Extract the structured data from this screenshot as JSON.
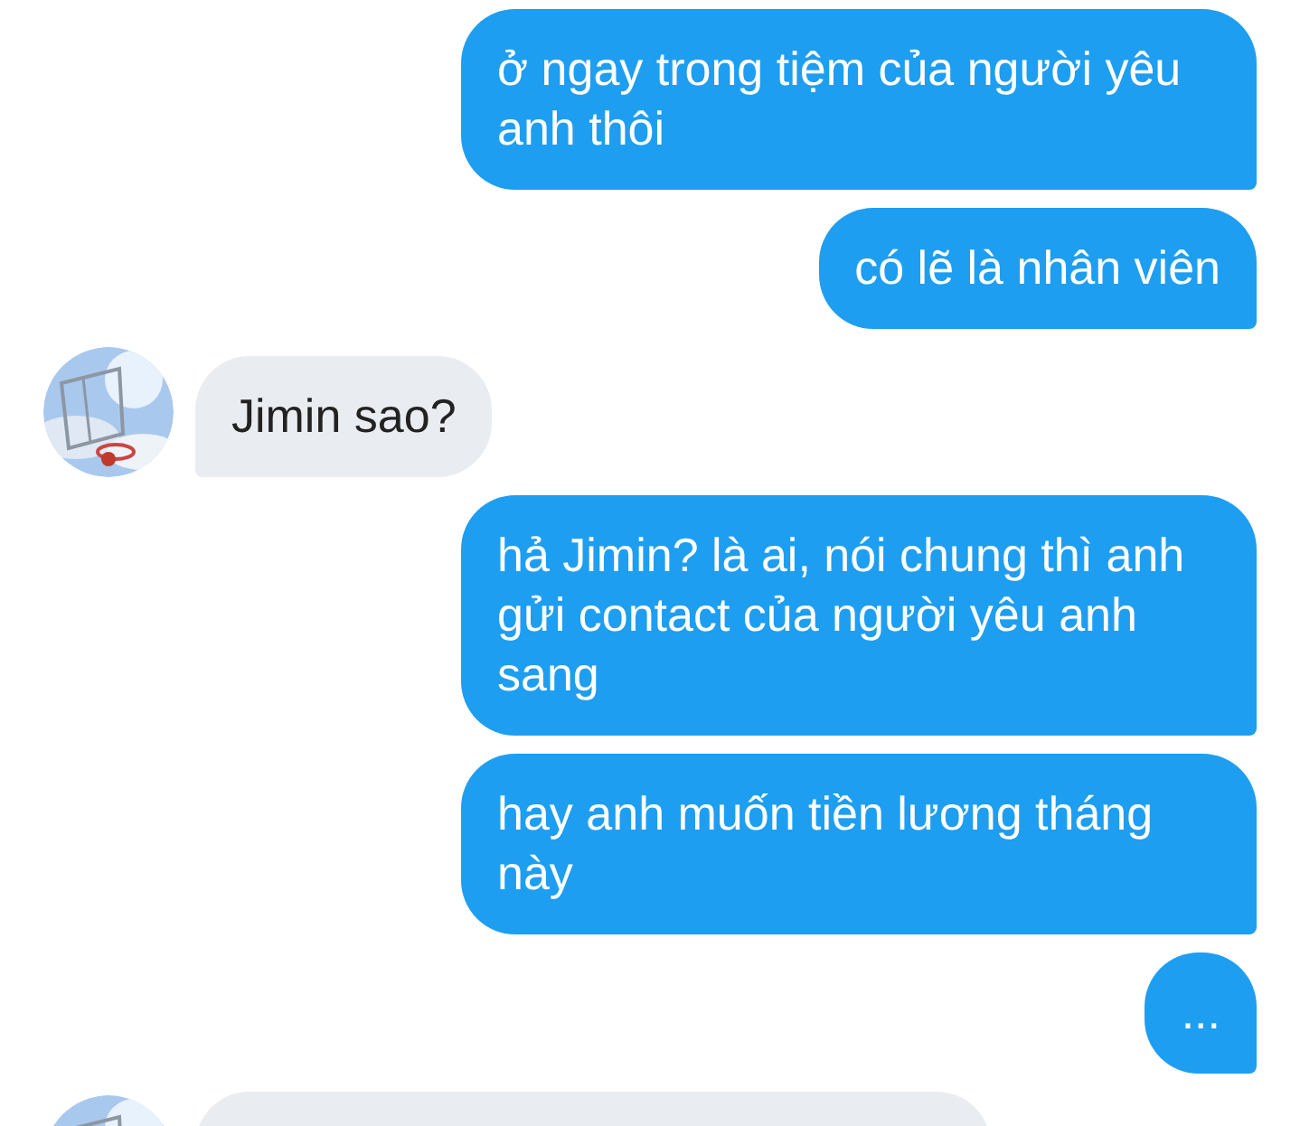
{
  "messages": [
    {
      "kind": "outgoing",
      "text": "ở ngay trong tiệm của người yêu anh thôi"
    },
    {
      "kind": "outgoing",
      "text": "có lẽ là nhân viên"
    },
    {
      "kind": "incoming",
      "text": "Jimin sao?"
    },
    {
      "kind": "outgoing",
      "text": "hả Jimin? là ai, nói chung thì anh gửi contact của người yêu anh sang"
    },
    {
      "kind": "outgoing",
      "text": "hay anh muốn tiền lương tháng này"
    },
    {
      "kind": "outgoing",
      "text": "..."
    },
    {
      "kind": "incoming"
    }
  ]
}
